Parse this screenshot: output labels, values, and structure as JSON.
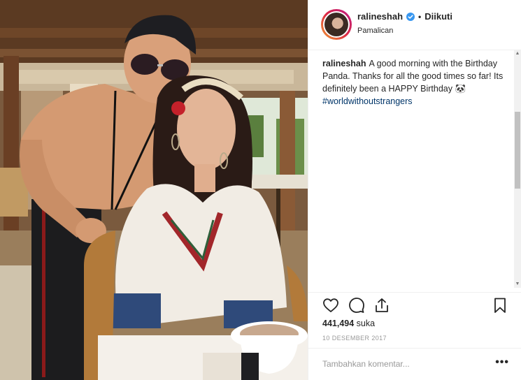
{
  "post": {
    "image_alt": "Photo",
    "header": {
      "username": "ralineshah",
      "separator": "•",
      "follow_status": "Diikuti",
      "location": "Pamalican"
    },
    "caption": {
      "username": "ralineshah",
      "text": "A good morning with the Birthday Panda. Thanks for all the good times so far! Its definitely been a HAPPY Birthday 🐼 ",
      "hashtag": "#worldwithoutstrangers"
    },
    "actions": {
      "like_icon": "heart-icon",
      "comment_icon": "comment-icon",
      "share_icon": "share-icon",
      "save_icon": "bookmark-icon"
    },
    "likes": {
      "count": "441,494",
      "label": "suka"
    },
    "date": "10 DESEMBER 2017",
    "comment": {
      "placeholder": "Tambahkan komentar...",
      "more_label": "•••"
    }
  },
  "colors": {
    "verified_badge": "#3897f0",
    "hashtag": "#003569",
    "border": "#efefef",
    "muted_text": "#999999"
  }
}
